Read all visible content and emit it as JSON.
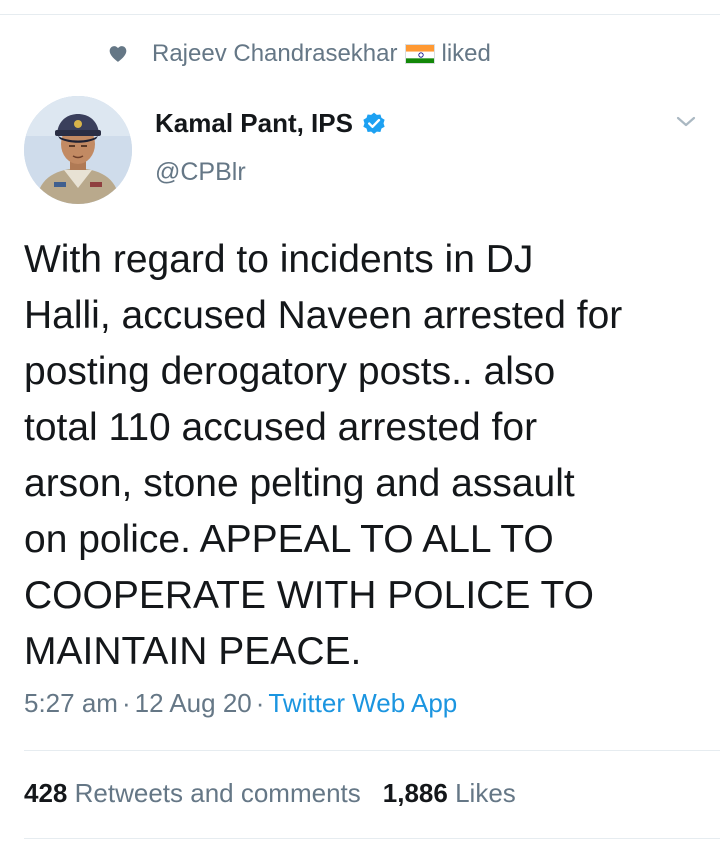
{
  "social_context": {
    "liker_name": "Rajeev Chandrasekhar",
    "action": "liked",
    "icon": "heart-icon",
    "flag": "indian-flag-icon"
  },
  "author": {
    "name": "Kamal Pant, IPS",
    "handle": "@CPBlr",
    "verified": true,
    "verified_color": "#1da1f2",
    "avatar": "avatar-photo"
  },
  "tweet": {
    "lines": [
      "With regard to incidents in DJ",
      "Halli, accused Naveen arrested for",
      "posting derogatory posts.. also",
      "total 110 accused arrested for",
      "arson, stone pelting and assault",
      "on police. APPEAL TO ALL TO",
      "COOPERATE WITH POLICE TO",
      "MAINTAIN PEACE."
    ]
  },
  "meta": {
    "time": "5:27 am",
    "separator": "·",
    "date": "12 Aug 20",
    "source": "Twitter Web App",
    "source_color": "#1b95e0"
  },
  "stats": {
    "retweets_count": "428",
    "retweets_label": "Retweets and comments",
    "likes_count": "1,886",
    "likes_label": "Likes"
  },
  "colors": {
    "text_primary": "#14171a",
    "text_secondary": "#657786",
    "divider": "#e6ecf0"
  }
}
